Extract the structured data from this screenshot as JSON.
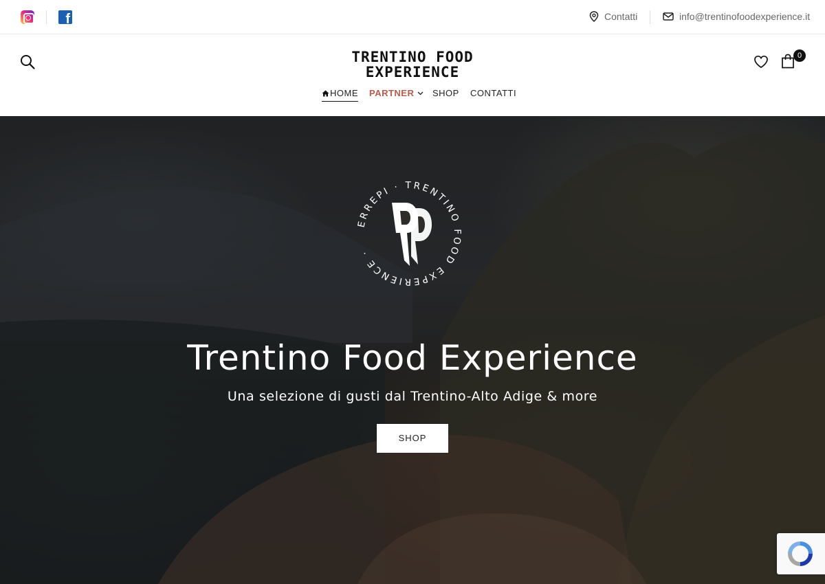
{
  "topbar": {
    "social": [
      {
        "name": "instagram-icon"
      },
      {
        "name": "facebook-icon"
      }
    ],
    "contact_label": "Contatti",
    "email": "info@trentinofoodexperience.it"
  },
  "header": {
    "logo_line1": "TRENTINO FOOD",
    "logo_line2": "EXPERIENCE",
    "cart_count": "0"
  },
  "nav": {
    "home": "HOME",
    "partner": "PARTNER",
    "shop": "SHOP",
    "contatti": "CONTATTI"
  },
  "hero": {
    "emblem_ring_text": "ERREPI · TRENTINO FOOD EXPERIENCE ·",
    "title": "Trentino Food Experience",
    "subtitle": "Una selezione di gusti dal Trentino-Alto Adige & more",
    "button": "SHOP"
  },
  "colors": {
    "accent": "#b85a4b",
    "text_dark": "#222222",
    "muted": "#666666"
  }
}
